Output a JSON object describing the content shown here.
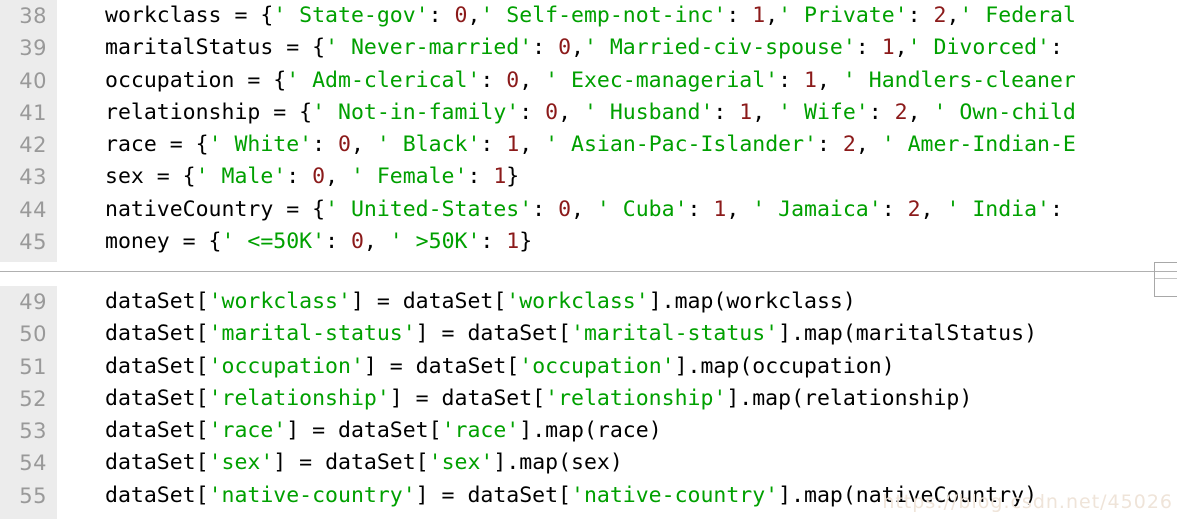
{
  "editor": {
    "language": "python",
    "colors": {
      "string": "#00a000",
      "number": "#8b1a1a",
      "text": "#000000",
      "gutter_bg": "#ececec",
      "gutter_text": "#999999",
      "background": "#ffffff",
      "divider": "#b0b0b0"
    }
  },
  "watermark": {
    "text": "https://blog.csdn.net/45026"
  },
  "blocks": [
    {
      "id": "label-encoding-dicts",
      "lines": [
        {
          "number": "38",
          "tokens": [
            {
              "t": "workclass = {",
              "k": "plain"
            },
            {
              "t": "' State-gov'",
              "k": "str"
            },
            {
              "t": ": ",
              "k": "plain"
            },
            {
              "t": "0",
              "k": "num"
            },
            {
              "t": ",",
              "k": "plain"
            },
            {
              "t": "' Self-emp-not-inc'",
              "k": "str"
            },
            {
              "t": ": ",
              "k": "plain"
            },
            {
              "t": "1",
              "k": "num"
            },
            {
              "t": ",",
              "k": "plain"
            },
            {
              "t": "' Private'",
              "k": "str"
            },
            {
              "t": ": ",
              "k": "plain"
            },
            {
              "t": "2",
              "k": "num"
            },
            {
              "t": ",",
              "k": "plain"
            },
            {
              "t": "' Federal",
              "k": "str"
            }
          ]
        },
        {
          "number": "39",
          "tokens": [
            {
              "t": "maritalStatus = {",
              "k": "plain"
            },
            {
              "t": "' Never-married'",
              "k": "str"
            },
            {
              "t": ": ",
              "k": "plain"
            },
            {
              "t": "0",
              "k": "num"
            },
            {
              "t": ",",
              "k": "plain"
            },
            {
              "t": "' Married-civ-spouse'",
              "k": "str"
            },
            {
              "t": ": ",
              "k": "plain"
            },
            {
              "t": "1",
              "k": "num"
            },
            {
              "t": ",",
              "k": "plain"
            },
            {
              "t": "' Divorced'",
              "k": "str"
            },
            {
              "t": ":",
              "k": "plain"
            }
          ]
        },
        {
          "number": "40",
          "tokens": [
            {
              "t": "occupation = {",
              "k": "plain"
            },
            {
              "t": "' Adm-clerical'",
              "k": "str"
            },
            {
              "t": ": ",
              "k": "plain"
            },
            {
              "t": "0",
              "k": "num"
            },
            {
              "t": ", ",
              "k": "plain"
            },
            {
              "t": "' Exec-managerial'",
              "k": "str"
            },
            {
              "t": ": ",
              "k": "plain"
            },
            {
              "t": "1",
              "k": "num"
            },
            {
              "t": ", ",
              "k": "plain"
            },
            {
              "t": "' Handlers-cleaner",
              "k": "str"
            }
          ]
        },
        {
          "number": "41",
          "tokens": [
            {
              "t": "relationship = {",
              "k": "plain"
            },
            {
              "t": "' Not-in-family'",
              "k": "str"
            },
            {
              "t": ": ",
              "k": "plain"
            },
            {
              "t": "0",
              "k": "num"
            },
            {
              "t": ", ",
              "k": "plain"
            },
            {
              "t": "' Husband'",
              "k": "str"
            },
            {
              "t": ": ",
              "k": "plain"
            },
            {
              "t": "1",
              "k": "num"
            },
            {
              "t": ", ",
              "k": "plain"
            },
            {
              "t": "' Wife'",
              "k": "str"
            },
            {
              "t": ": ",
              "k": "plain"
            },
            {
              "t": "2",
              "k": "num"
            },
            {
              "t": ", ",
              "k": "plain"
            },
            {
              "t": "' Own-child",
              "k": "str"
            }
          ]
        },
        {
          "number": "42",
          "tokens": [
            {
              "t": "race = {",
              "k": "plain"
            },
            {
              "t": "' White'",
              "k": "str"
            },
            {
              "t": ": ",
              "k": "plain"
            },
            {
              "t": "0",
              "k": "num"
            },
            {
              "t": ", ",
              "k": "plain"
            },
            {
              "t": "' Black'",
              "k": "str"
            },
            {
              "t": ": ",
              "k": "plain"
            },
            {
              "t": "1",
              "k": "num"
            },
            {
              "t": ", ",
              "k": "plain"
            },
            {
              "t": "' Asian-Pac-Islander'",
              "k": "str"
            },
            {
              "t": ": ",
              "k": "plain"
            },
            {
              "t": "2",
              "k": "num"
            },
            {
              "t": ", ",
              "k": "plain"
            },
            {
              "t": "' Amer-Indian-E",
              "k": "str"
            }
          ]
        },
        {
          "number": "43",
          "tokens": [
            {
              "t": "sex = {",
              "k": "plain"
            },
            {
              "t": "' Male'",
              "k": "str"
            },
            {
              "t": ": ",
              "k": "plain"
            },
            {
              "t": "0",
              "k": "num"
            },
            {
              "t": ", ",
              "k": "plain"
            },
            {
              "t": "' Female'",
              "k": "str"
            },
            {
              "t": ": ",
              "k": "plain"
            },
            {
              "t": "1",
              "k": "num"
            },
            {
              "t": "}",
              "k": "plain"
            }
          ]
        },
        {
          "number": "44",
          "tokens": [
            {
              "t": "nativeCountry = {",
              "k": "plain"
            },
            {
              "t": "' United-States'",
              "k": "str"
            },
            {
              "t": ": ",
              "k": "plain"
            },
            {
              "t": "0",
              "k": "num"
            },
            {
              "t": ", ",
              "k": "plain"
            },
            {
              "t": "' Cuba'",
              "k": "str"
            },
            {
              "t": ": ",
              "k": "plain"
            },
            {
              "t": "1",
              "k": "num"
            },
            {
              "t": ", ",
              "k": "plain"
            },
            {
              "t": "' Jamaica'",
              "k": "str"
            },
            {
              "t": ": ",
              "k": "plain"
            },
            {
              "t": "2",
              "k": "num"
            },
            {
              "t": ", ",
              "k": "plain"
            },
            {
              "t": "' India'",
              "k": "str"
            },
            {
              "t": ":",
              "k": "plain"
            }
          ]
        },
        {
          "number": "45",
          "tokens": [
            {
              "t": "money = {",
              "k": "plain"
            },
            {
              "t": "' <=50K'",
              "k": "str"
            },
            {
              "t": ": ",
              "k": "plain"
            },
            {
              "t": "0",
              "k": "num"
            },
            {
              "t": ", ",
              "k": "plain"
            },
            {
              "t": "' >50K'",
              "k": "str"
            },
            {
              "t": ": ",
              "k": "plain"
            },
            {
              "t": "1",
              "k": "num"
            },
            {
              "t": "}",
              "k": "plain"
            }
          ]
        }
      ]
    },
    {
      "id": "column-mapping-calls",
      "lines": [
        {
          "number": "49",
          "tokens": [
            {
              "t": "dataSet[",
              "k": "plain"
            },
            {
              "t": "'workclass'",
              "k": "str"
            },
            {
              "t": "] = dataSet[",
              "k": "plain"
            },
            {
              "t": "'workclass'",
              "k": "str"
            },
            {
              "t": "].map(workclass)",
              "k": "plain"
            }
          ]
        },
        {
          "number": "50",
          "tokens": [
            {
              "t": "dataSet[",
              "k": "plain"
            },
            {
              "t": "'marital-status'",
              "k": "str"
            },
            {
              "t": "] = dataSet[",
              "k": "plain"
            },
            {
              "t": "'marital-status'",
              "k": "str"
            },
            {
              "t": "].map(maritalStatus)",
              "k": "plain"
            }
          ]
        },
        {
          "number": "51",
          "tokens": [
            {
              "t": "dataSet[",
              "k": "plain"
            },
            {
              "t": "'occupation'",
              "k": "str"
            },
            {
              "t": "] = dataSet[",
              "k": "plain"
            },
            {
              "t": "'occupation'",
              "k": "str"
            },
            {
              "t": "].map(occupation)",
              "k": "plain"
            }
          ]
        },
        {
          "number": "52",
          "tokens": [
            {
              "t": "dataSet[",
              "k": "plain"
            },
            {
              "t": "'relationship'",
              "k": "str"
            },
            {
              "t": "] = dataSet[",
              "k": "plain"
            },
            {
              "t": "'relationship'",
              "k": "str"
            },
            {
              "t": "].map(relationship)",
              "k": "plain"
            }
          ]
        },
        {
          "number": "53",
          "tokens": [
            {
              "t": "dataSet[",
              "k": "plain"
            },
            {
              "t": "'race'",
              "k": "str"
            },
            {
              "t": "] = dataSet[",
              "k": "plain"
            },
            {
              "t": "'race'",
              "k": "str"
            },
            {
              "t": "].map(race)",
              "k": "plain"
            }
          ]
        },
        {
          "number": "54",
          "tokens": [
            {
              "t": "dataSet[",
              "k": "plain"
            },
            {
              "t": "'sex'",
              "k": "str"
            },
            {
              "t": "] = dataSet[",
              "k": "plain"
            },
            {
              "t": "'sex'",
              "k": "str"
            },
            {
              "t": "].map(sex)",
              "k": "plain"
            }
          ]
        },
        {
          "number": "55",
          "tokens": [
            {
              "t": "dataSet[",
              "k": "plain"
            },
            {
              "t": "'native-country'",
              "k": "str"
            },
            {
              "t": "] = dataSet[",
              "k": "plain"
            },
            {
              "t": "'native-country'",
              "k": "str"
            },
            {
              "t": "].map(nativeCountry)",
              "k": "plain"
            }
          ]
        }
      ]
    }
  ]
}
